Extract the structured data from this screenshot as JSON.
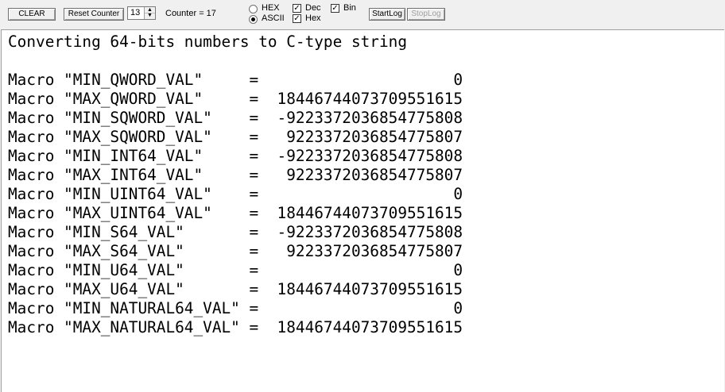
{
  "toolbar": {
    "clear_label": "CLEAR",
    "reset_counter_label": "Reset Counter",
    "spin_value": "13",
    "counter_text": "Counter = 17",
    "hex_radio_label": "HEX",
    "ascii_radio_label": "ASCII",
    "dec_check_label": "Dec",
    "hex_check_label": "Hex",
    "bin_check_label": "Bin",
    "startlog_label": "StartLog",
    "stoplog_label": "StopLog",
    "check_mark": "✓",
    "radio_selected": "ASCII"
  },
  "console": {
    "title": "Converting 64-bits numbers to C-type string",
    "lines": [
      "Macro \"MIN_QWORD_VAL\"     =                     0",
      "Macro \"MAX_QWORD_VAL\"     =  18446744073709551615",
      "Macro \"MIN_SQWORD_VAL\"    =  -9223372036854775808",
      "Macro \"MAX_SQWORD_VAL\"    =   9223372036854775807",
      "Macro \"MIN_INT64_VAL\"     =  -9223372036854775808",
      "Macro \"MAX_INT64_VAL\"     =   9223372036854775807",
      "Macro \"MIN_UINT64_VAL\"    =                     0",
      "Macro \"MAX_UINT64_VAL\"    =  18446744073709551615",
      "Macro \"MIN_S64_VAL\"       =  -9223372036854775808",
      "Macro \"MAX_S64_VAL\"       =   9223372036854775807",
      "Macro \"MIN_U64_VAL\"       =                     0",
      "Macro \"MAX_U64_VAL\"       =  18446744073709551615",
      "Macro \"MIN_NATURAL64_VAL\" =                     0",
      "Macro \"MAX_NATURAL64_VAL\" =  18446744073709551615"
    ]
  }
}
